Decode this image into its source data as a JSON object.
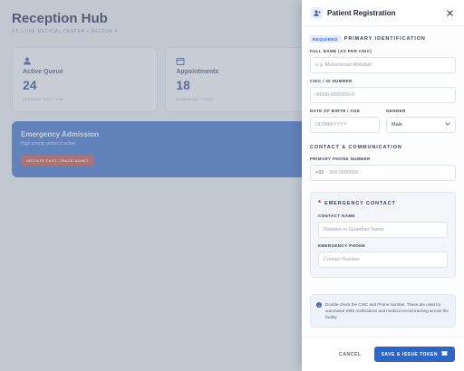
{
  "background": {
    "title": "Reception Hub",
    "subtitle": "ST. LUKE MEDICAL CENTER • SECTOR 4",
    "stats": [
      {
        "label": "Active Queue",
        "value": "24",
        "foot": "AVERAGE WAIT: 12M",
        "icon": "users-icon"
      },
      {
        "label": "Appointments",
        "value": "18",
        "foot": "REMAINING TODAY",
        "icon": "calendar-icon"
      }
    ],
    "emergency": {
      "title": "Emergency Admission",
      "subtitle": "High priority protocol active",
      "button": "INITIATE FAST-TRACK ADMIT"
    }
  },
  "drawer": {
    "title": "Patient Registration",
    "header_icon": "user-plus-icon",
    "close_icon": "close-icon",
    "primary": {
      "badge": "REQUIRED",
      "title": "PRIMARY IDENTIFICATION",
      "full_name": {
        "label": "FULL NAME (AS PER CNIC)",
        "placeholder": "e.g. Muhammad Abdullah"
      },
      "cnic": {
        "label": "CNIC / ID NUMBER",
        "placeholder": "00000-0000000-0"
      },
      "dob": {
        "label": "DATE OF BIRTH / AGE",
        "placeholder": "DD/MM/YYYY"
      },
      "gender": {
        "label": "GENDER",
        "value": "Male"
      }
    },
    "contact": {
      "title": "CONTACT & COMMUNICATION",
      "phone": {
        "label": "PRIMARY PHONE NUMBER",
        "prefix": "+92",
        "placeholder": "300 0000000"
      }
    },
    "emergency_contact": {
      "asterisk": "*",
      "title": "EMERGENCY CONTACT",
      "name": {
        "label": "CONTACT NAME",
        "placeholder": "Relative or Guardian Name"
      },
      "phone": {
        "label": "EMERGENCY PHONE",
        "placeholder": "Contact Number"
      }
    },
    "info": {
      "icon_glyph": "i",
      "text": "Double-check the CNIC and Phone Number. These are used for automated SMS notifications and medical record tracking across the facility."
    },
    "footer": {
      "cancel": "CANCEL",
      "save": "SAVE & ISSUE TOKEN",
      "save_icon": "ticket-icon"
    }
  },
  "colors": {
    "accent": "#2e66c8",
    "badge_bg": "#e1eafb",
    "emergency_asterisk": "#c63a2a",
    "overlay": "#8c96a8"
  }
}
